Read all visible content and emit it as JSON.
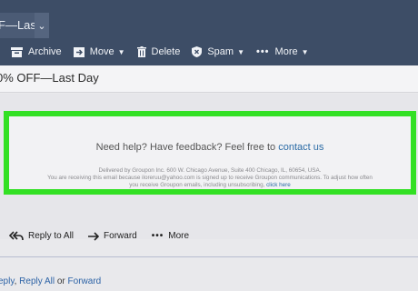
{
  "tab": {
    "title": "F—Last",
    "dropdown_icon": "chevron-down-icon"
  },
  "toolbar": {
    "archive": "Archive",
    "move": "Move",
    "delete": "Delete",
    "spam": "Spam",
    "more": "More"
  },
  "email": {
    "subject": "0% OFF—Last Day",
    "help_text": "Need help? Have feedback? Feel free to",
    "help_link": "contact us",
    "footer_line1": "Delivered by Groupon Inc. 600 W. Chicago Avenue, Suite 400 Chicago, IL, 60654, USA.",
    "footer_line2": "You are receiving this email because iloreruu@yahoo.com is signed up to receive Groupon communications. To adjust how often",
    "footer_line3_text": "you receive Groupon emails, including unsubscribing,",
    "footer_line3_link": "click here"
  },
  "actions": {
    "reply_all": "Reply to All",
    "forward": "Forward",
    "more": "More"
  },
  "footer": {
    "reply": "eply",
    "sep1": ", ",
    "reply_all": "Reply All",
    "or": " or ",
    "forward": "Forward"
  },
  "colors": {
    "topbar": "#3d4d66",
    "highlight": "#33e024",
    "link": "#2a6aa5"
  }
}
